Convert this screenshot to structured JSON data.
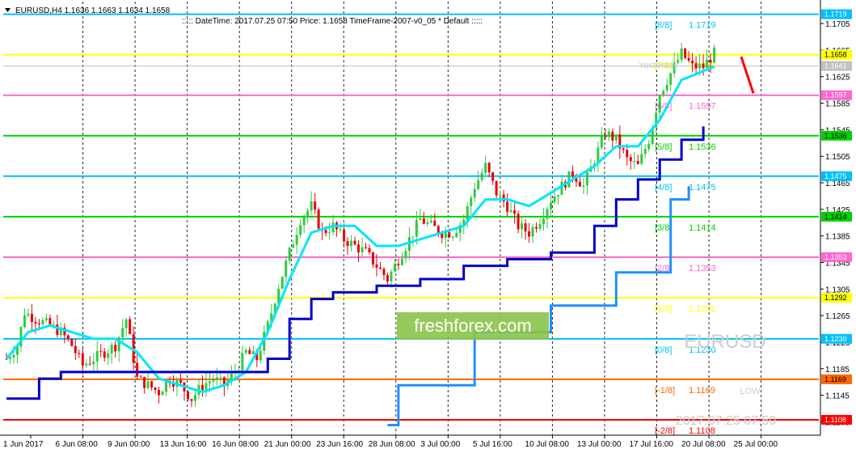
{
  "header": {
    "symbol": "EURUSD,H4  1.1636 1.1663 1.1634 1.1658",
    "info": ":::::  DateTime: 2017.07.25 07:50    Price: 1.1658    TimeFrame-2007-v0_05    *  Default  :::::"
  },
  "watermark": {
    "logo": "freshforex.com",
    "symbol": "EURUSD",
    "datetime": "2017.07.25 07:50",
    "low_label": "LOW",
    "yesterday_label": "Yesterday"
  },
  "colors": {
    "background": "#ffffff",
    "candle_up": "#2ecc40",
    "candle_down": "#e8000b",
    "fast_line": "#00e5ff",
    "fast_line_alt": "#ff00ff",
    "slow_line": "#0000c8",
    "slowest_line": "#1e90ff",
    "logo_bg": "#8bc34a"
  },
  "chart_data": {
    "type": "candlestick",
    "title": "EURUSD,H4",
    "ylim": [
      1.1086,
      1.1738
    ],
    "y_ticks": [
      "1.1705",
      "1.1665",
      "1.1625",
      "1.1585",
      "1.1545",
      "1.1505",
      "1.1465",
      "1.1425",
      "1.1385",
      "1.1345",
      "1.1305",
      "1.1265",
      "1.1225",
      "1.1185",
      "1.1145",
      "1.1105"
    ],
    "x_labels": [
      "1 Jun 2017",
      "6 Jun 08:00",
      "9 Jun 00:00",
      "13 Jun 16:00",
      "16 Jun 08:00",
      "21 Jun 00:00",
      "23 Jun 16:00",
      "28 Jun 08:00",
      "3 Jul 00:00",
      "5 Jul 16:00",
      "10 Jul 08:00",
      "13 Jul 00:00",
      "17 Jul 16:00",
      "20 Jul 08:00",
      "25 Jul 00:00"
    ],
    "murrey_levels": [
      {
        "label": "[8/8]",
        "value": "1.1719",
        "color": "#00bfff"
      },
      {
        "label": "[7/8]",
        "value": "1.1658",
        "color": "#ffff00"
      },
      {
        "label": "[6/8]",
        "value": "1.1597",
        "color": "#ff66cc"
      },
      {
        "label": "[5/8]",
        "value": "1.1536",
        "color": "#00d000"
      },
      {
        "label": "[4/8]",
        "value": "1.1475",
        "color": "#00bfff"
      },
      {
        "label": "[3/8]",
        "value": "1.1414",
        "color": "#00d000"
      },
      {
        "label": "[2/8]",
        "value": "1.1353",
        "color": "#ff66cc"
      },
      {
        "label": "[1/8]",
        "value": "1.1292",
        "color": "#ffff00"
      },
      {
        "label": "[0/8]",
        "value": "1.1230",
        "color": "#00bfff"
      },
      {
        "label": "[-1/8]",
        "value": "1.1169",
        "color": "#ff6600"
      },
      {
        "label": "[-2/8]",
        "value": "1.1108",
        "color": "#ff0000"
      }
    ],
    "current_price": "1.1641",
    "close_path": [
      [
        0,
        1.12
      ],
      [
        3,
        1.122
      ],
      [
        5,
        1.127
      ],
      [
        8,
        1.126
      ],
      [
        12,
        1.125
      ],
      [
        15,
        1.124
      ],
      [
        18,
        1.122
      ],
      [
        21,
        1.119
      ],
      [
        24,
        1.12
      ],
      [
        27,
        1.121
      ],
      [
        30,
        1.122
      ],
      [
        33,
        1.126
      ],
      [
        36,
        1.117
      ],
      [
        39,
        1.116
      ],
      [
        42,
        1.115
      ],
      [
        45,
        1.117
      ],
      [
        48,
        1.116
      ],
      [
        51,
        1.114
      ],
      [
        54,
        1.116
      ],
      [
        57,
        1.117
      ],
      [
        60,
        1.116
      ],
      [
        63,
        1.118
      ],
      [
        66,
        1.121
      ],
      [
        69,
        1.12
      ],
      [
        72,
        1.125
      ],
      [
        75,
        1.131
      ],
      [
        78,
        1.136
      ],
      [
        81,
        1.141
      ],
      [
        84,
        1.143
      ],
      [
        87,
        1.139
      ],
      [
        90,
        1.14
      ],
      [
        93,
        1.138
      ],
      [
        96,
        1.137
      ],
      [
        99,
        1.136
      ],
      [
        102,
        1.134
      ],
      [
        105,
        1.132
      ],
      [
        108,
        1.135
      ],
      [
        111,
        1.138
      ],
      [
        114,
        1.141
      ],
      [
        117,
        1.14
      ],
      [
        120,
        1.139
      ],
      [
        123,
        1.139
      ],
      [
        126,
        1.141
      ],
      [
        129,
        1.146
      ],
      [
        132,
        1.149
      ],
      [
        135,
        1.145
      ],
      [
        138,
        1.143
      ],
      [
        141,
        1.14
      ],
      [
        144,
        1.139
      ],
      [
        147,
        1.141
      ],
      [
        150,
        1.144
      ],
      [
        153,
        1.146
      ],
      [
        156,
        1.148
      ],
      [
        159,
        1.146
      ],
      [
        162,
        1.15
      ],
      [
        165,
        1.154
      ],
      [
        168,
        1.153
      ],
      [
        171,
        1.15
      ],
      [
        174,
        1.149
      ],
      [
        177,
        1.153
      ],
      [
        180,
        1.16
      ],
      [
        183,
        1.163
      ],
      [
        186,
        1.166
      ],
      [
        189,
        1.164
      ],
      [
        192,
        1.164
      ],
      [
        195,
        1.166
      ]
    ],
    "fast_ma": [
      [
        0,
        1.12
      ],
      [
        6,
        1.124
      ],
      [
        12,
        1.125
      ],
      [
        18,
        1.124
      ],
      [
        24,
        1.123
      ],
      [
        30,
        1.123
      ],
      [
        36,
        1.121
      ],
      [
        42,
        1.117
      ],
      [
        48,
        1.116
      ],
      [
        54,
        1.115
      ],
      [
        60,
        1.116
      ],
      [
        66,
        1.118
      ],
      [
        72,
        1.124
      ],
      [
        78,
        1.132
      ],
      [
        84,
        1.139
      ],
      [
        90,
        1.14
      ],
      [
        96,
        1.14
      ],
      [
        102,
        1.137
      ],
      [
        108,
        1.137
      ],
      [
        114,
        1.138
      ],
      [
        120,
        1.139
      ],
      [
        126,
        1.14
      ],
      [
        132,
        1.144
      ],
      [
        138,
        1.144
      ],
      [
        144,
        1.143
      ],
      [
        150,
        1.145
      ],
      [
        156,
        1.147
      ],
      [
        162,
        1.149
      ],
      [
        168,
        1.152
      ],
      [
        174,
        1.152
      ],
      [
        180,
        1.156
      ],
      [
        186,
        1.162
      ],
      [
        195,
        1.164
      ]
    ],
    "slow_ma": [
      [
        0,
        1.114
      ],
      [
        9,
        1.117
      ],
      [
        15,
        1.118
      ],
      [
        30,
        1.118
      ],
      [
        45,
        1.118
      ],
      [
        60,
        1.118
      ],
      [
        66,
        1.118
      ],
      [
        72,
        1.12
      ],
      [
        78,
        1.126
      ],
      [
        84,
        1.129
      ],
      [
        90,
        1.13
      ],
      [
        102,
        1.131
      ],
      [
        114,
        1.132
      ],
      [
        126,
        1.134
      ],
      [
        138,
        1.135
      ],
      [
        150,
        1.136
      ],
      [
        162,
        1.14
      ],
      [
        168,
        1.144
      ],
      [
        174,
        1.147
      ],
      [
        180,
        1.15
      ],
      [
        186,
        1.153
      ],
      [
        192,
        1.155
      ]
    ],
    "slowest_ma": [
      [
        105,
        1.11
      ],
      [
        108,
        1.116
      ],
      [
        126,
        1.116
      ],
      [
        129,
        1.124
      ],
      [
        147,
        1.124
      ],
      [
        150,
        1.128
      ],
      [
        165,
        1.128
      ],
      [
        168,
        1.133
      ],
      [
        180,
        1.133
      ],
      [
        183,
        1.144
      ],
      [
        188,
        1.146
      ]
    ]
  }
}
